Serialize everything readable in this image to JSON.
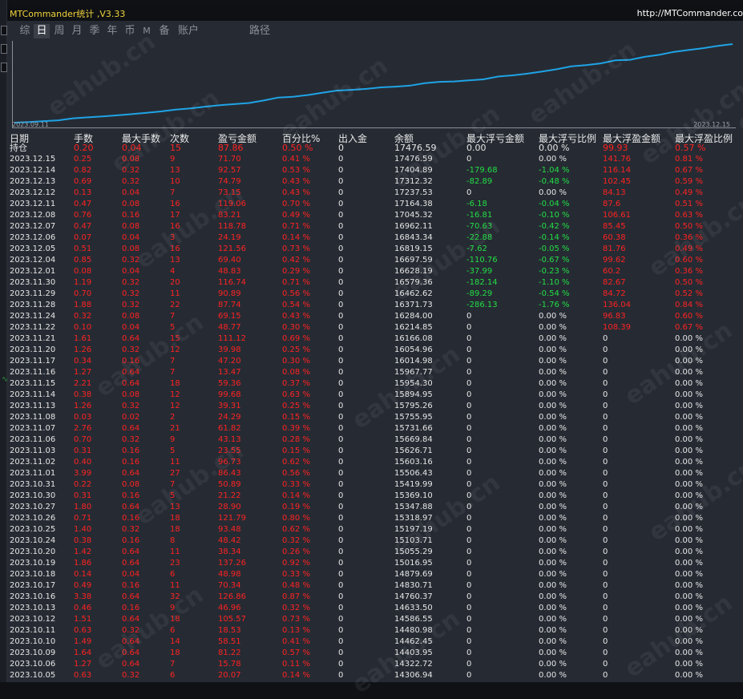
{
  "window": {
    "title": "MTCommander统计 ,V3.33",
    "url": "http://MTCommander.co"
  },
  "tabs": [
    "综",
    "日",
    "周",
    "月",
    "季",
    "年",
    "币",
    "M",
    "备",
    "账户",
    "路径"
  ],
  "active_tab": "日",
  "chart": {
    "start_label": "2023.09.11",
    "end_label": "2023.12.15",
    "line_color": "#1fa3e6",
    "type": "line",
    "values": [
      14306.94,
      14330,
      14370,
      14400,
      14480,
      14520,
      14560,
      14600,
      14650,
      14700,
      14760,
      14830,
      14880,
      14950,
      15010,
      15055,
      15100,
      15200,
      15320,
      15350,
      15420,
      15510,
      15600,
      15630,
      15670,
      15730,
      15760,
      15800,
      15900,
      15955,
      15970,
      16015,
      16055,
      16166,
      16215,
      16284,
      16372,
      16462,
      16579,
      16628,
      16698,
      16819,
      16843,
      16962,
      17045,
      17164,
      17237,
      17312,
      17405,
      17477
    ]
  },
  "columns": [
    "日期",
    "手数",
    "最大手数",
    "次数",
    "盈亏金额",
    "百分比%",
    "出入金",
    "余额",
    "最大浮亏金额",
    "最大浮亏比例",
    "最大浮盈金额",
    "最大浮盈比例"
  ],
  "rows": [
    [
      "持仓",
      "0.20",
      "0.04",
      "15",
      "87.86",
      "0.50 %",
      "0",
      "17476.59",
      "0.00",
      "0.00 %",
      "99.93",
      "0.57 %"
    ],
    [
      "2023.12.15",
      "0.25",
      "0.08",
      "9",
      "71.70",
      "0.41 %",
      "0",
      "17476.59",
      "0",
      "0.00 %",
      "141.76",
      "0.81 %"
    ],
    [
      "2023.12.14",
      "0.82",
      "0.32",
      "13",
      "92.57",
      "0.53 %",
      "0",
      "17404.89",
      "-179.68",
      "-1.04 %",
      "116.14",
      "0.67 %"
    ],
    [
      "2023.12.13",
      "0.69",
      "0.32",
      "10",
      "74.79",
      "0.43 %",
      "0",
      "17312.32",
      "-82.89",
      "-0.48 %",
      "102.45",
      "0.59 %"
    ],
    [
      "2023.12.12",
      "0.13",
      "0.04",
      "7",
      "73.15",
      "0.43 %",
      "0",
      "17237.53",
      "0",
      "0.00 %",
      "84.13",
      "0.49 %"
    ],
    [
      "2023.12.11",
      "0.47",
      "0.08",
      "16",
      "119.06",
      "0.70 %",
      "0",
      "17164.38",
      "-6.18",
      "-0.04 %",
      "87.6",
      "0.51 %"
    ],
    [
      "2023.12.08",
      "0.76",
      "0.16",
      "17",
      "83.21",
      "0.49 %",
      "0",
      "17045.32",
      "-16.81",
      "-0.10 %",
      "106.61",
      "0.63 %"
    ],
    [
      "2023.12.07",
      "0.47",
      "0.08",
      "16",
      "118.78",
      "0.71 %",
      "0",
      "16962.11",
      "-70.63",
      "-0.42 %",
      "85.45",
      "0.50 %"
    ],
    [
      "2023.12.06",
      "0.07",
      "0.04",
      "3",
      "24.19",
      "0.14 %",
      "0",
      "16843.34",
      "-22.88",
      "-0.14 %",
      "60.38",
      "0.36 %"
    ],
    [
      "2023.12.05",
      "0.51",
      "0.08",
      "16",
      "121.56",
      "0.73 %",
      "0",
      "16819.15",
      "-7.62",
      "-0.05 %",
      "81.76",
      "0.49 %"
    ],
    [
      "2023.12.04",
      "0.85",
      "0.32",
      "13",
      "69.40",
      "0.42 %",
      "0",
      "16697.59",
      "-110.76",
      "-0.67 %",
      "99.62",
      "0.60 %"
    ],
    [
      "2023.12.01",
      "0.08",
      "0.04",
      "4",
      "48.83",
      "0.29 %",
      "0",
      "16628.19",
      "-37.99",
      "-0.23 %",
      "60.2",
      "0.36 %"
    ],
    [
      "2023.11.30",
      "1.19",
      "0.32",
      "20",
      "116.74",
      "0.71 %",
      "0",
      "16579.36",
      "-182.14",
      "-1.10 %",
      "82.67",
      "0.50 %"
    ],
    [
      "2023.11.29",
      "0.70",
      "0.32",
      "11",
      "90.89",
      "0.56 %",
      "0",
      "16462.62",
      "-89.29",
      "-0.54 %",
      "84.72",
      "0.52 %"
    ],
    [
      "2023.11.28",
      "1.88",
      "0.32",
      "22",
      "87.74",
      "0.54 %",
      "0",
      "16371.73",
      "-286.13",
      "-1.76 %",
      "136.04",
      "0.84 %"
    ],
    [
      "2023.11.24",
      "0.32",
      "0.08",
      "7",
      "69.15",
      "0.43 %",
      "0",
      "16284.00",
      "0",
      "0.00 %",
      "96.83",
      "0.60 %"
    ],
    [
      "2023.11.22",
      "0.10",
      "0.04",
      "5",
      "48.77",
      "0.30 %",
      "0",
      "16214.85",
      "0",
      "0.00 %",
      "108.39",
      "0.67 %"
    ],
    [
      "2023.11.21",
      "1.61",
      "0.64",
      "15",
      "111.12",
      "0.69 %",
      "0",
      "16166.08",
      "0",
      "0.00 %",
      "0",
      "0.00 %"
    ],
    [
      "2023.11.20",
      "1.26",
      "0.32",
      "12",
      "39.98",
      "0.25 %",
      "0",
      "16054.96",
      "0",
      "0.00 %",
      "0",
      "0.00 %"
    ],
    [
      "2023.11.17",
      "0.34",
      "0.16",
      "7",
      "47.20",
      "0.30 %",
      "0",
      "16014.98",
      "0",
      "0.00 %",
      "0",
      "0.00 %"
    ],
    [
      "2023.11.16",
      "1.27",
      "0.64",
      "7",
      "13.47",
      "0.08 %",
      "0",
      "15967.77",
      "0",
      "0.00 %",
      "0",
      "0.00 %"
    ],
    [
      "2023.11.15",
      "2.21",
      "0.64",
      "18",
      "59.36",
      "0.37 %",
      "0",
      "15954.30",
      "0",
      "0.00 %",
      "0",
      "0.00 %"
    ],
    [
      "2023.11.14",
      "0.38",
      "0.08",
      "12",
      "99.68",
      "0.63 %",
      "0",
      "15894.95",
      "0",
      "0.00 %",
      "0",
      "0.00 %"
    ],
    [
      "2023.11.13",
      "1.26",
      "0.32",
      "12",
      "39.31",
      "0.25 %",
      "0",
      "15795.26",
      "0",
      "0.00 %",
      "0",
      "0.00 %"
    ],
    [
      "2023.11.08",
      "0.03",
      "0.02",
      "2",
      "24.29",
      "0.15 %",
      "0",
      "15755.95",
      "0",
      "0.00 %",
      "0",
      "0.00 %"
    ],
    [
      "2023.11.07",
      "2.76",
      "0.64",
      "21",
      "61.82",
      "0.39 %",
      "0",
      "15731.66",
      "0",
      "0.00 %",
      "0",
      "0.00 %"
    ],
    [
      "2023.11.06",
      "0.70",
      "0.32",
      "9",
      "43.13",
      "0.28 %",
      "0",
      "15669.84",
      "0",
      "0.00 %",
      "0",
      "0.00 %"
    ],
    [
      "2023.11.03",
      "0.31",
      "0.16",
      "5",
      "23.55",
      "0.15 %",
      "0",
      "15626.71",
      "0",
      "0.00 %",
      "0",
      "0.00 %"
    ],
    [
      "2023.11.02",
      "0.40",
      "0.16",
      "11",
      "96.73",
      "0.62 %",
      "0",
      "15603.16",
      "0",
      "0.00 %",
      "0",
      "0.00 %"
    ],
    [
      "2023.11.01",
      "3.99",
      "0.64",
      "27",
      "86.43",
      "0.56 %",
      "0",
      "15506.43",
      "0",
      "0.00 %",
      "0",
      "0.00 %"
    ],
    [
      "2023.10.31",
      "0.22",
      "0.08",
      "7",
      "50.89",
      "0.33 %",
      "0",
      "15419.99",
      "0",
      "0.00 %",
      "0",
      "0.00 %"
    ],
    [
      "2023.10.30",
      "0.31",
      "0.16",
      "5",
      "21.22",
      "0.14 %",
      "0",
      "15369.10",
      "0",
      "0.00 %",
      "0",
      "0.00 %"
    ],
    [
      "2023.10.27",
      "1.80",
      "0.64",
      "13",
      "28.90",
      "0.19 %",
      "0",
      "15347.88",
      "0",
      "0.00 %",
      "0",
      "0.00 %"
    ],
    [
      "2023.10.26",
      "0.71",
      "0.16",
      "18",
      "121.79",
      "0.80 %",
      "0",
      "15318.97",
      "0",
      "0.00 %",
      "0",
      "0.00 %"
    ],
    [
      "2023.10.25",
      "1.40",
      "0.32",
      "18",
      "93.48",
      "0.62 %",
      "0",
      "15197.19",
      "0",
      "0.00 %",
      "0",
      "0.00 %"
    ],
    [
      "2023.10.24",
      "0.38",
      "0.16",
      "8",
      "48.42",
      "0.32 %",
      "0",
      "15103.71",
      "0",
      "0.00 %",
      "0",
      "0.00 %"
    ],
    [
      "2023.10.20",
      "1.42",
      "0.64",
      "11",
      "38.34",
      "0.26 %",
      "0",
      "15055.29",
      "0",
      "0.00 %",
      "0",
      "0.00 %"
    ],
    [
      "2023.10.19",
      "1.86",
      "0.64",
      "23",
      "137.26",
      "0.92 %",
      "0",
      "15016.95",
      "0",
      "0.00 %",
      "0",
      "0.00 %"
    ],
    [
      "2023.10.18",
      "0.14",
      "0.04",
      "6",
      "48.98",
      "0.33 %",
      "0",
      "14879.69",
      "0",
      "0.00 %",
      "0",
      "0.00 %"
    ],
    [
      "2023.10.17",
      "0.49",
      "0.16",
      "11",
      "70.34",
      "0.48 %",
      "0",
      "14830.71",
      "0",
      "0.00 %",
      "0",
      "0.00 %"
    ],
    [
      "2023.10.16",
      "3.38",
      "0.64",
      "32",
      "126.86",
      "0.87 %",
      "0",
      "14760.37",
      "0",
      "0.00 %",
      "0",
      "0.00 %"
    ],
    [
      "2023.10.13",
      "0.46",
      "0.16",
      "9",
      "46.96",
      "0.32 %",
      "0",
      "14633.50",
      "0",
      "0.00 %",
      "0",
      "0.00 %"
    ],
    [
      "2023.10.12",
      "1.51",
      "0.64",
      "18",
      "105.57",
      "0.73 %",
      "0",
      "14586.55",
      "0",
      "0.00 %",
      "0",
      "0.00 %"
    ],
    [
      "2023.10.11",
      "0.63",
      "0.32",
      "6",
      "18.53",
      "0.13 %",
      "0",
      "14480.98",
      "0",
      "0.00 %",
      "0",
      "0.00 %"
    ],
    [
      "2023.10.10",
      "1.49",
      "0.64",
      "14",
      "58.51",
      "0.41 %",
      "0",
      "14462.45",
      "0",
      "0.00 %",
      "0",
      "0.00 %"
    ],
    [
      "2023.10.09",
      "1.64",
      "0.64",
      "18",
      "81.22",
      "0.57 %",
      "0",
      "14403.95",
      "0",
      "0.00 %",
      "0",
      "0.00 %"
    ],
    [
      "2023.10.06",
      "1.27",
      "0.64",
      "7",
      "15.78",
      "0.11 %",
      "0",
      "14322.72",
      "0",
      "0.00 %",
      "0",
      "0.00 %"
    ],
    [
      "2023.10.05",
      "0.63",
      "0.32",
      "6",
      "20.07",
      "0.14 %",
      "0",
      "14306.94",
      "0",
      "0.00 %",
      "0",
      "0.00 %"
    ]
  ],
  "watermark": "eahub.cn"
}
